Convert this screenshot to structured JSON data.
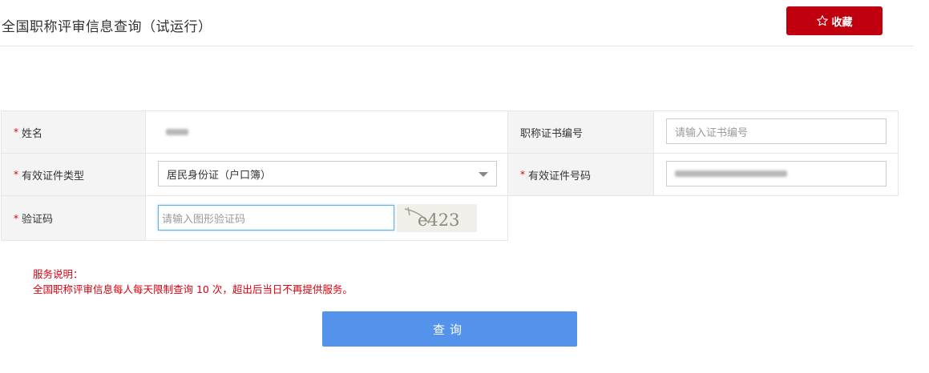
{
  "header": {
    "title": "全国职称评审信息查询（试运行）",
    "favorite_label": "收藏"
  },
  "form": {
    "name": {
      "label": "姓名",
      "required_mark": "*"
    },
    "cert_number": {
      "label": "职称证书编号",
      "placeholder": "请输入证书编号"
    },
    "id_type": {
      "label": "有效证件类型",
      "required_mark": "*",
      "selected": "居民身份证（户口簿）"
    },
    "id_number": {
      "label": "有效证件号码",
      "required_mark": "*"
    },
    "captcha": {
      "label": "验证码",
      "required_mark": "*",
      "placeholder": "请输入图形验证码",
      "image_text": "e423"
    }
  },
  "notice": {
    "title": "服务说明：",
    "body": "全国职称评审信息每人每天限制查询 10 次，超出后当日不再提供服务。"
  },
  "query_button": "查询",
  "colors": {
    "brand_red": "#c0000f",
    "required_red": "#d9000f",
    "primary_blue": "#5493ec"
  }
}
